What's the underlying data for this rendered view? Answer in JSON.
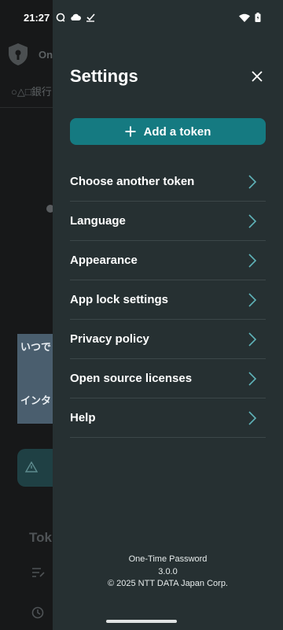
{
  "status_bar": {
    "time": "21:27",
    "left_icons": [
      "chat-icon",
      "cloud-icon",
      "check-icon"
    ],
    "right_icons": [
      "wifi-icon",
      "battery-icon"
    ]
  },
  "background": {
    "header_fragment": "On",
    "account_fragment": "○△□銀行",
    "card_line1": "いつで",
    "card_line2": "インタ",
    "section_fragment": "Tok"
  },
  "settings": {
    "title": "Settings",
    "add_token_label": "Add a token",
    "menu_items": [
      {
        "label": "Choose another token"
      },
      {
        "label": "Language"
      },
      {
        "label": "Appearance"
      },
      {
        "label": "App lock settings"
      },
      {
        "label": "Privacy policy"
      },
      {
        "label": "Open source licenses"
      },
      {
        "label": "Help"
      }
    ],
    "footer": {
      "app_name": "One-Time Password",
      "version": "3.0.0",
      "copyright": "© 2025 NTT DATA Japan Corp."
    }
  },
  "colors": {
    "accent": "#157a81",
    "drawer_bg": "#263032",
    "chevron": "#5fb2b8"
  }
}
